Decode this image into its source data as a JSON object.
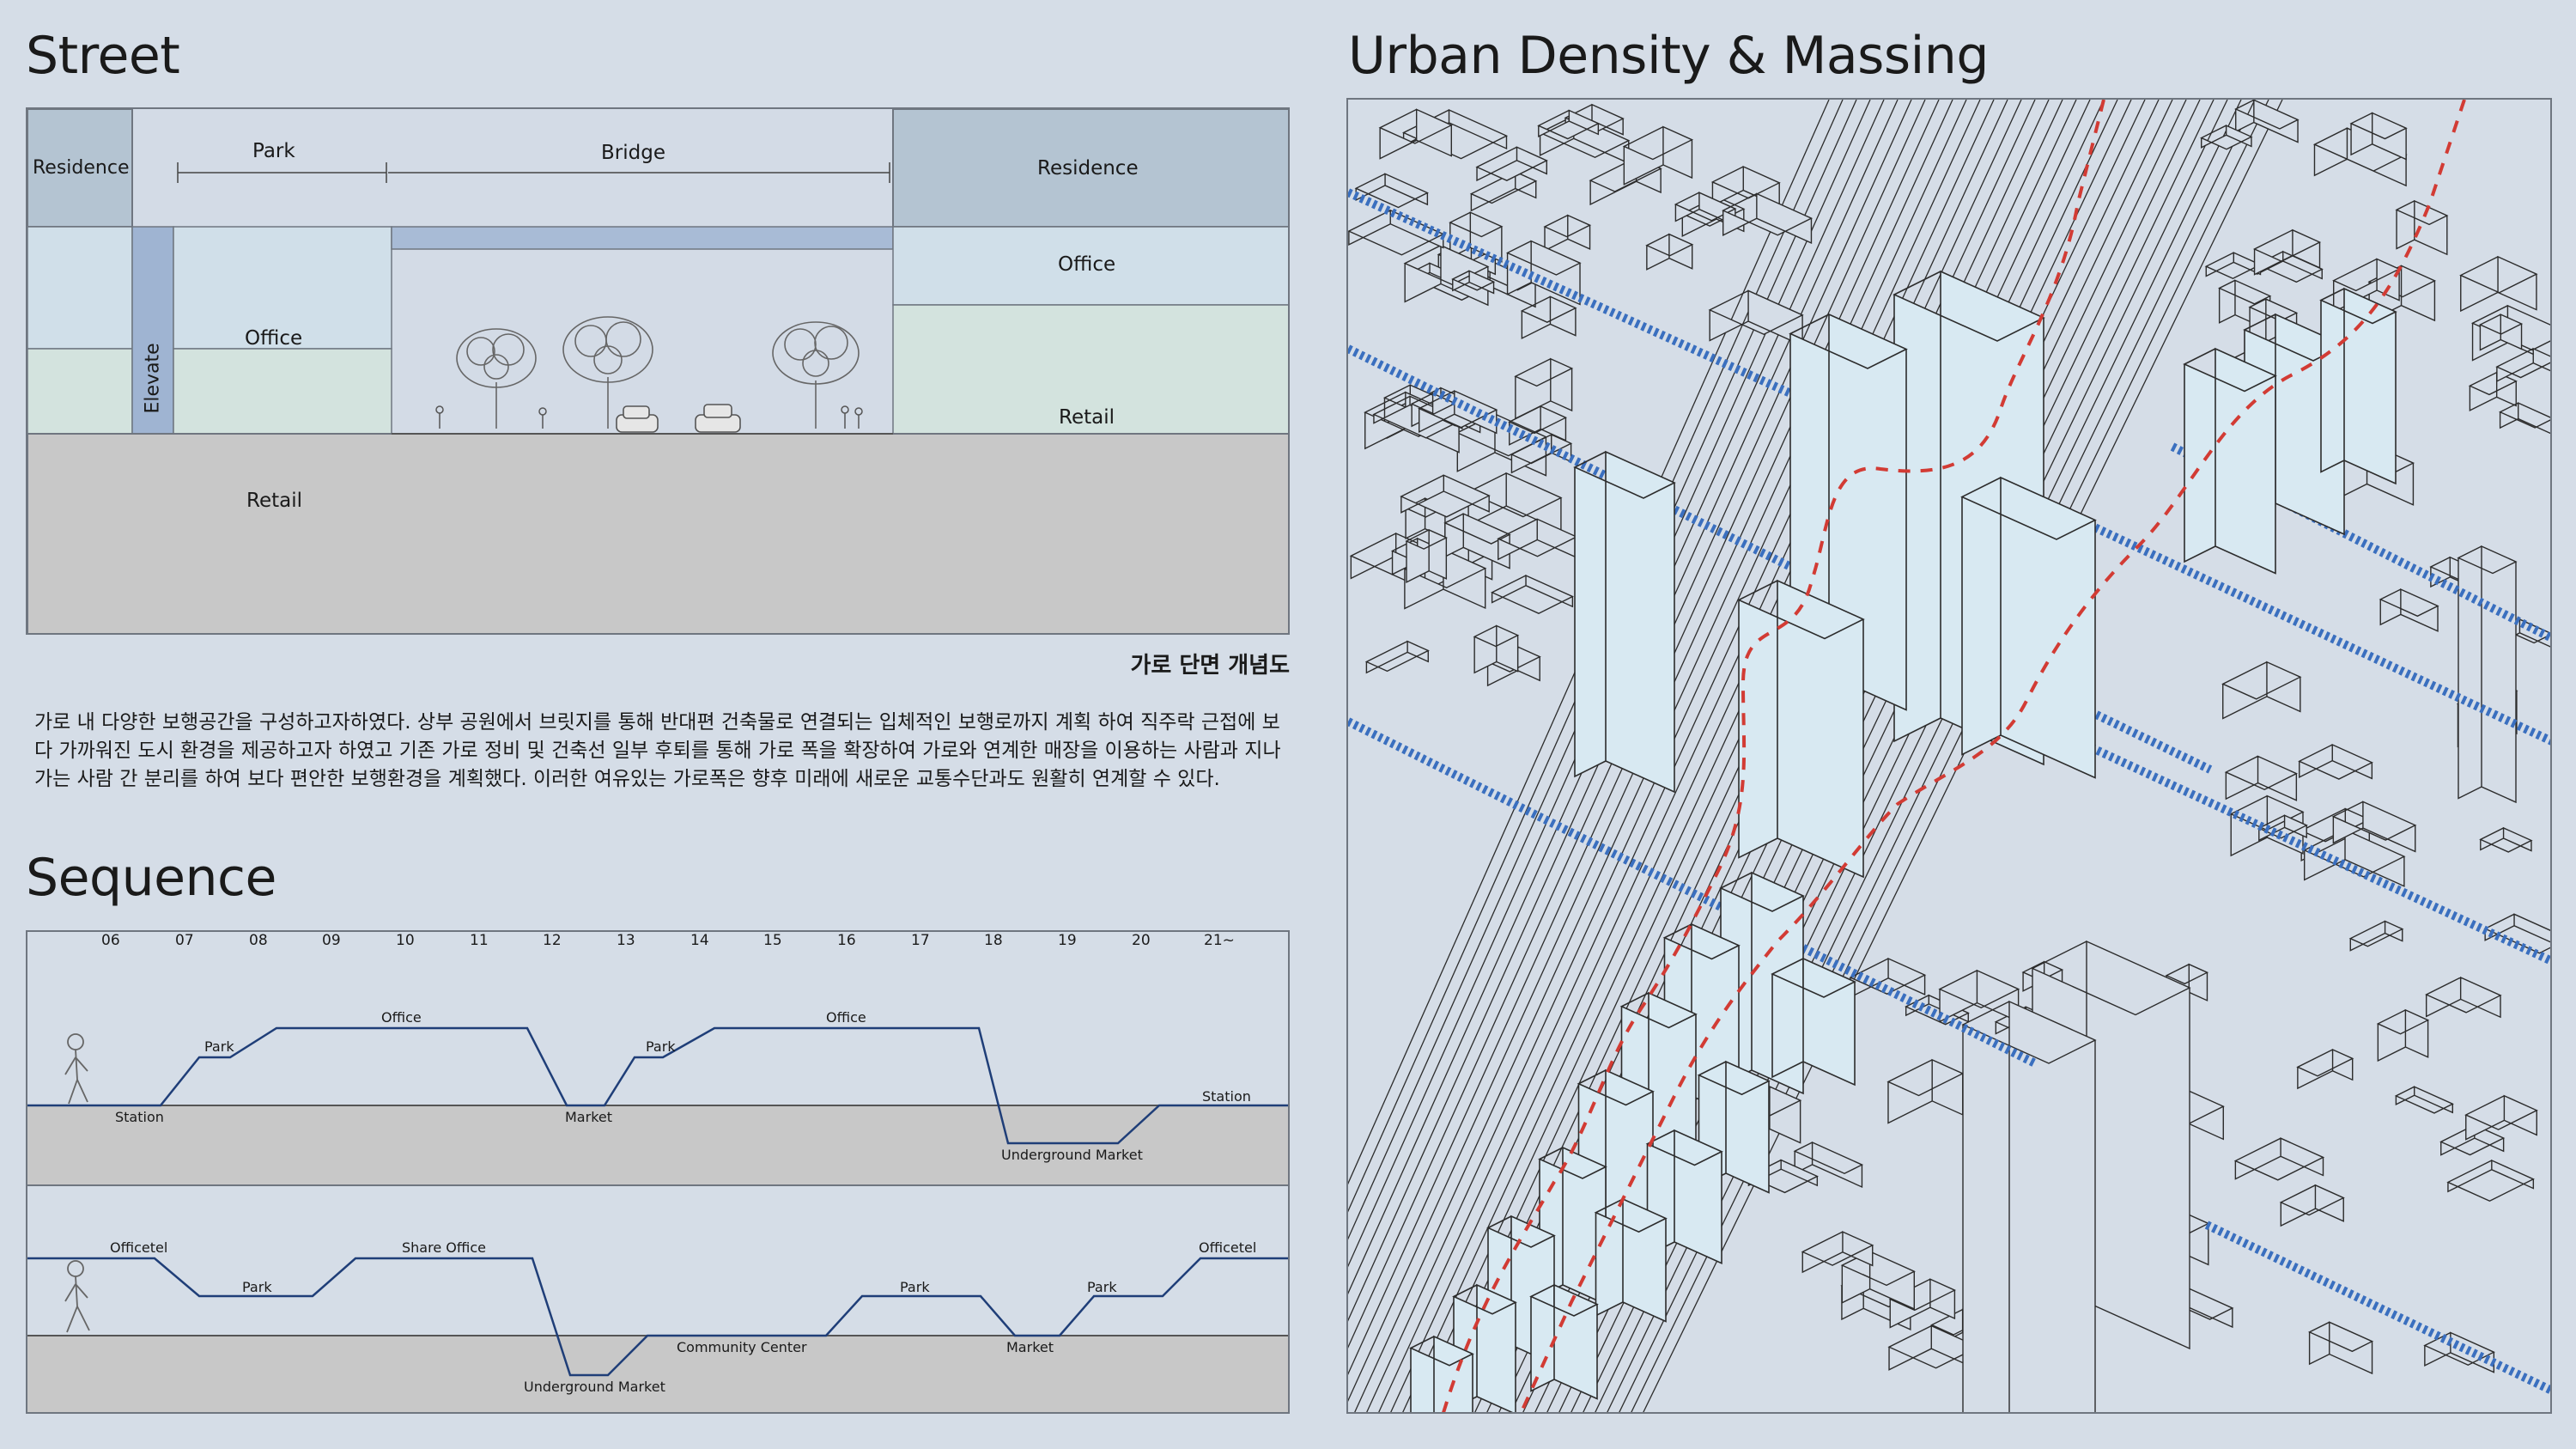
{
  "street": {
    "title": "Street",
    "labels": {
      "residence_left": "Residence",
      "park": "Park",
      "bridge": "Bridge",
      "residence_right": "Residence",
      "office_right": "Office",
      "elevate": "Elevate",
      "office_left": "Office",
      "retail_right": "Retail",
      "retail_left": "Retail"
    },
    "caption": "가로 단면 개념도",
    "description": "가로 내 다양한 보행공간을 구성하고자하였다. 상부 공원에서  브릿지를 통해 반대편 건축물로 연결되는 입체적인 보행로까지 계획 하여 직주락 근접에 보다 가까워진 도시 환경을 제공하고자 하였고 기존 가로 정비 및 건축선 일부 후퇴를 통해 가로 폭을 확장하여 가로와 연계한 매장을 이용하는 사람과 지나가는 사람 간 분리를 하여 보다 편안한 보행환경을 계획했다. 이러한 여유있는 가로폭은 향후 미래에 새로운 교통수단과도 원활히 연계할 수 있다."
  },
  "sequence": {
    "title": "Sequence",
    "hours": [
      "06",
      "07",
      "08",
      "09",
      "10",
      "11",
      "12",
      "13",
      "14",
      "15",
      "16",
      "17",
      "18",
      "19",
      "20",
      "21~"
    ],
    "row1": [
      "Station",
      "Park",
      "Office",
      "Market",
      "Park",
      "Office",
      "Underground Market",
      "Station"
    ],
    "row2": [
      "Officetel",
      "Park",
      "Share Office",
      "Underground Market",
      "Community Center",
      "Park",
      "Market",
      "Park",
      "Officetel"
    ]
  },
  "massing": {
    "title": "Urban Density & Massing"
  },
  "colors": {
    "background": "#d5dde7",
    "residence": "#b4c4d2",
    "office": "#d0dfe9",
    "retail": "#d3e3de",
    "elevate": "#9fb4d2",
    "bridge": "#a8bbd6",
    "ground": "#c8c8c8",
    "route_line": "#1f3e78",
    "red_path": "#d23b34",
    "blue_dashed": "#3a6fbf",
    "building_highlight": "#d8e9f2"
  }
}
